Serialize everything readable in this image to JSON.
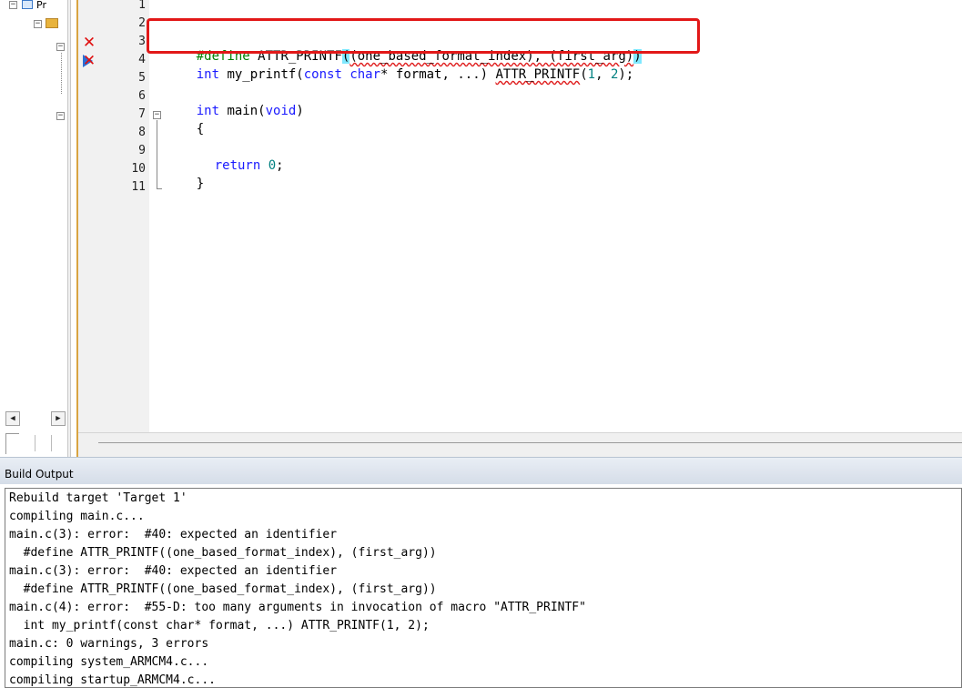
{
  "project_tree": {
    "root_label": "Pr",
    "expand_symbol": "−"
  },
  "editor": {
    "line_numbers": [
      "1",
      "2",
      "3",
      "4",
      "5",
      "6",
      "7",
      "8",
      "9",
      "10",
      "11"
    ],
    "lines": {
      "l3_directive": "#define",
      "l3_macro": " ATTR_PRINTF",
      "l3_open_paren": "(",
      "l3_args": "(one_based_format_index), (first_arg)",
      "l3_close_paren": ")",
      "l4_int": "int",
      "l4_mid": " my_printf(",
      "l4_const": "const",
      "l4_sp": " ",
      "l4_char": "char",
      "l4_rest": "* format, ...) ",
      "l4_macro": "ATTR_PRINTF",
      "l4_open": "(",
      "l4_num1": "1",
      "l4_comma": ", ",
      "l4_num2": "2",
      "l4_close": ");",
      "l6_int": "int",
      "l6_main": " main(",
      "l6_void": "void",
      "l6_close": ")",
      "l7_brace": "{",
      "l9_return": "return",
      "l9_sp": " ",
      "l9_zero": "0",
      "l9_semi": ";",
      "l10_brace": "}"
    },
    "error_marker_symbol": "✕",
    "fold_symbol": "−"
  },
  "scroll": {
    "left_arrow": "◀",
    "right_arrow": "▶"
  },
  "build_output": {
    "title": "Build Output",
    "lines": [
      "Rebuild target 'Target 1'",
      "compiling main.c...",
      "main.c(3): error:  #40: expected an identifier",
      "  #define ATTR_PRINTF((one_based_format_index), (first_arg))",
      "main.c(3): error:  #40: expected an identifier",
      "  #define ATTR_PRINTF((one_based_format_index), (first_arg))",
      "main.c(4): error:  #55-D: too many arguments in invocation of macro \"ATTR_PRINTF\"",
      "  int my_printf(const char* format, ...) ATTR_PRINTF(1, 2);",
      "main.c: 0 warnings, 3 errors",
      "compiling system_ARMCM4.c...",
      "compiling startup_ARMCM4.c..."
    ]
  },
  "colors": {
    "error_red": "#e01010",
    "keyword_blue": "#1a1aff",
    "preprocessor_green": "#008000",
    "number_teal": "#008080",
    "current_line_green": "#e6f9e6",
    "highlight_box_red": "#e21818"
  }
}
